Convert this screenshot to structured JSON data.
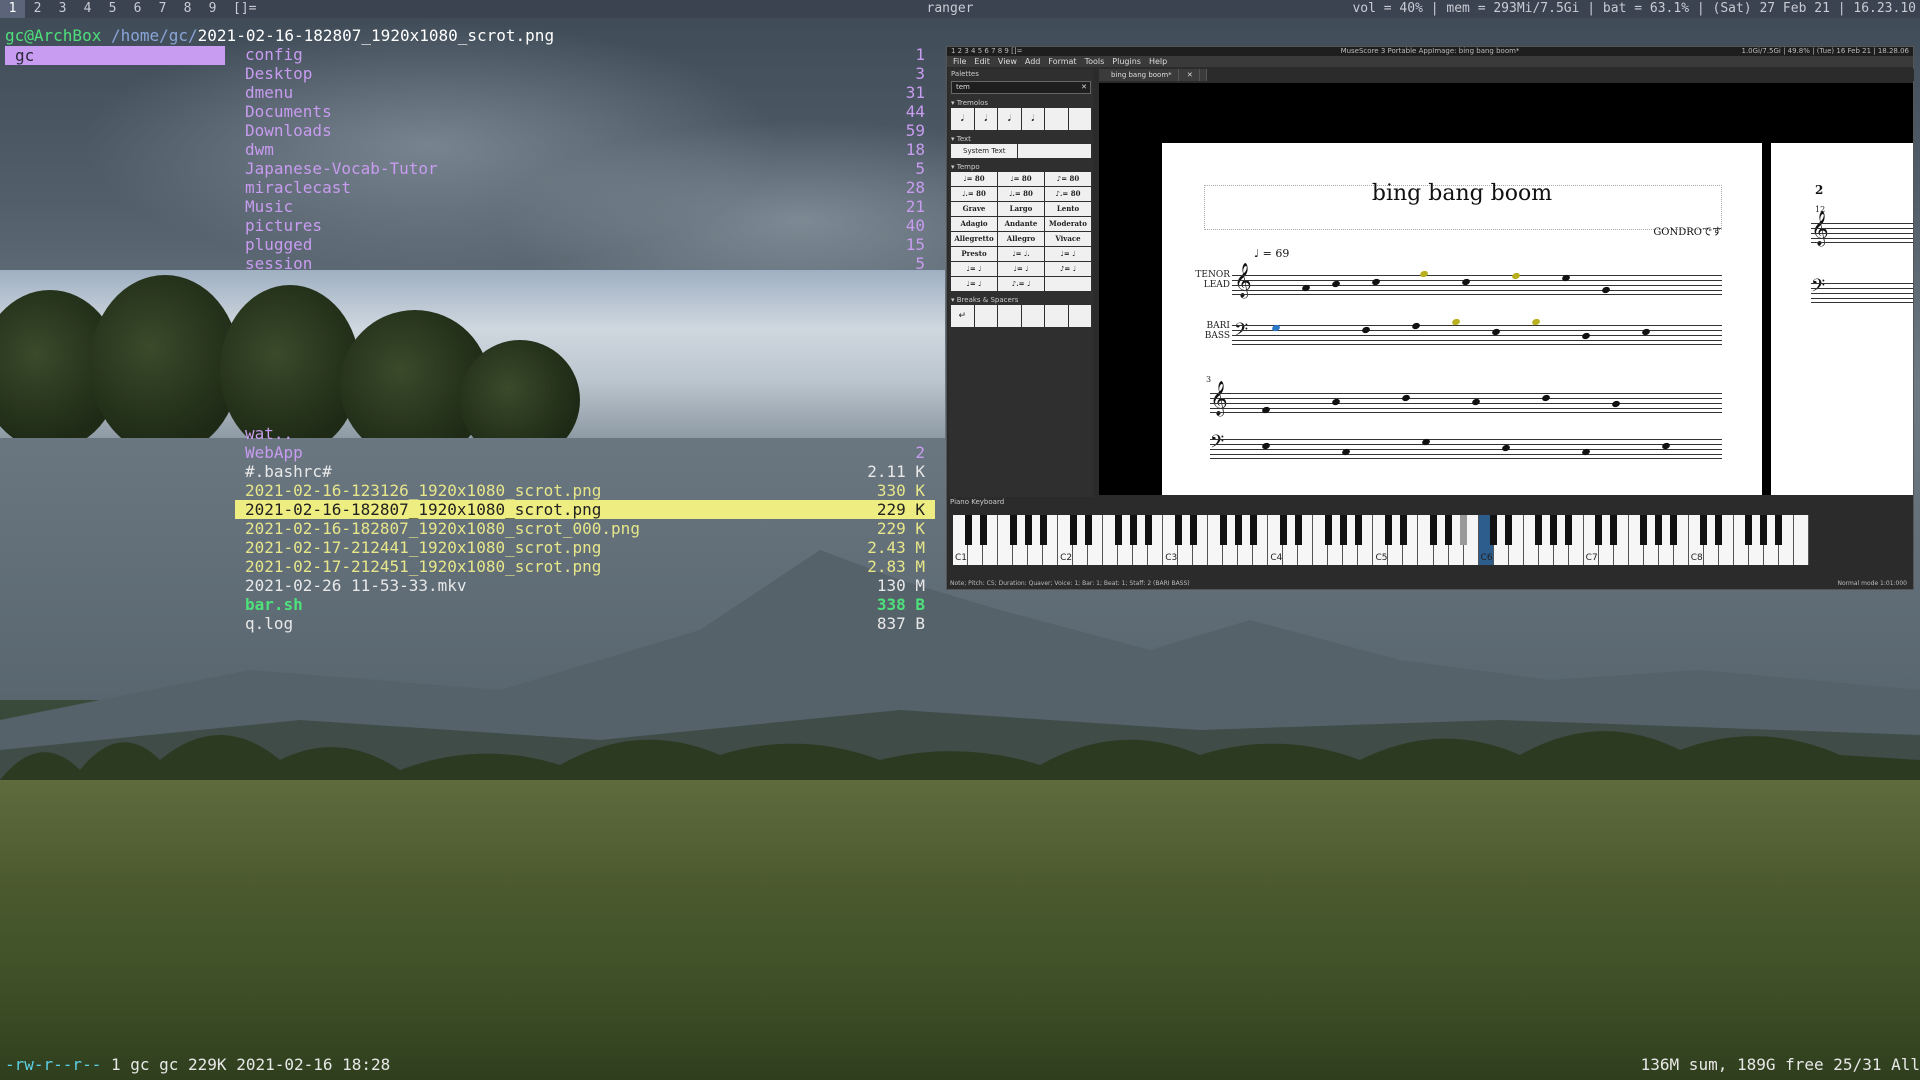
{
  "topbar": {
    "tags": [
      "1",
      "2",
      "3",
      "4",
      "5",
      "6",
      "7",
      "8",
      "9"
    ],
    "active_tag": "1",
    "layout": "[]=",
    "window_title": "ranger",
    "status": "vol = 40% | mem = 293Mi/7.5Gi | bat = 63.1% | (Sat) 27 Feb 21 | 16.23.10"
  },
  "ranger": {
    "host": "gc@ArchBox",
    "dir": " /home/gc/",
    "file": "2021-02-16-182807_1920x1080_scrot.png",
    "parent_item": "gc",
    "entries": [
      {
        "name": "config",
        "size": "1",
        "type": "dir"
      },
      {
        "name": "Desktop",
        "size": "3",
        "type": "dir"
      },
      {
        "name": "dmenu",
        "size": "31",
        "type": "dir"
      },
      {
        "name": "Documents",
        "size": "44",
        "type": "dir"
      },
      {
        "name": "Downloads",
        "size": "59",
        "type": "dir"
      },
      {
        "name": "dwm",
        "size": "18",
        "type": "dir"
      },
      {
        "name": "Japanese-Vocab-Tutor",
        "size": "5",
        "type": "dir"
      },
      {
        "name": "miraclecast",
        "size": "28",
        "type": "dir"
      },
      {
        "name": "Music",
        "size": "21",
        "type": "dir"
      },
      {
        "name": "pictures",
        "size": "40",
        "type": "dir"
      },
      {
        "name": "plugged",
        "size": "15",
        "type": "dir"
      },
      {
        "name": "session",
        "size": "5",
        "type": "dir"
      }
    ],
    "entries2": [
      {
        "name": "wat..",
        "size": "",
        "type": "dir"
      },
      {
        "name": "WebApp",
        "size": "2",
        "type": "dir"
      },
      {
        "name": "#.bashrc#",
        "size": "2.11 K",
        "type": "plain"
      },
      {
        "name": "2021-02-16-123126_1920x1080_scrot.png",
        "size": "330 K",
        "type": "img"
      },
      {
        "name": "2021-02-16-182807_1920x1080_scrot.png",
        "size": "229 K",
        "type": "sel"
      },
      {
        "name": "2021-02-16-182807_1920x1080_scrot_000.png",
        "size": "229 K",
        "type": "img"
      },
      {
        "name": "2021-02-17-212441_1920x1080_scrot.png",
        "size": "2.43 M",
        "type": "img"
      },
      {
        "name": "2021-02-17-212451_1920x1080_scrot.png",
        "size": "2.83 M",
        "type": "img"
      },
      {
        "name": "2021-02-26 11-53-33.mkv",
        "size": "130 M",
        "type": "plain"
      },
      {
        "name": "bar.sh",
        "size": "338 B",
        "type": "exec"
      },
      {
        "name": "q.log",
        "size": "837 B",
        "type": "plain"
      }
    ],
    "status_perm": "-rw-r--r--",
    "status_info": " 1 gc gc 229K 2021-02-16 18:28",
    "status_right": "136M sum, 189G free  25/31  All"
  },
  "musescore": {
    "title": "MuseScore 3 Portable AppImage: bing bang boom*",
    "mini_tags": "1 2 3 4 5 6 7 8 9 []=",
    "mini_status": "1.0Gi/7.5Gi | 49.8% | (Tue) 16 Feb 21 | 18.28.06",
    "menu": [
      "File",
      "Edit",
      "View",
      "Add",
      "Format",
      "Tools",
      "Plugins",
      "Help"
    ],
    "palettes_label": "Palettes",
    "search_value": "tem",
    "tremolos_label": "Tremolos",
    "text_label": "Text",
    "system_text": "System Text",
    "tempo_label": "Tempo",
    "tempo_cells": [
      "♩= 80",
      "♩= 80",
      "♪= 80",
      "♩.= 80",
      "♩.= 80",
      "♪.= 80",
      "Grave",
      "Largo",
      "Lento",
      "Adagio",
      "Andante",
      "Moderato",
      "Allegretto",
      "Allegro",
      "Vivace",
      "Presto",
      "♩= ♩.",
      "♩= ♩",
      "♩= ♩",
      "♩= ♩",
      "♪= ♩",
      "♩= ♩",
      "♪.= ♩",
      ""
    ],
    "breaks_label": "Breaks & Spacers",
    "tab_label": "bing bang boom*",
    "score_title": "bing bang boom",
    "composer": "GONDROです",
    "tempo_mark": "♩ = 69",
    "part1": "TENOR\nLEAD",
    "part2": "BARI\nBASS",
    "measure3": "3",
    "page2_num": "2",
    "page2_measure": "12",
    "piano_label": "Piano Keyboard",
    "octave_labels": [
      "C1",
      "C2",
      "C3",
      "C4",
      "C5",
      "C6",
      "C7",
      "C8"
    ],
    "status_left": "Note; Pitch: C5; Duration: Quaver; Voice: 1;  Bar: 1; Beat: 1; Staff: 2 (BARI BASS)",
    "status_right": "Normal mode    1:01:000"
  }
}
